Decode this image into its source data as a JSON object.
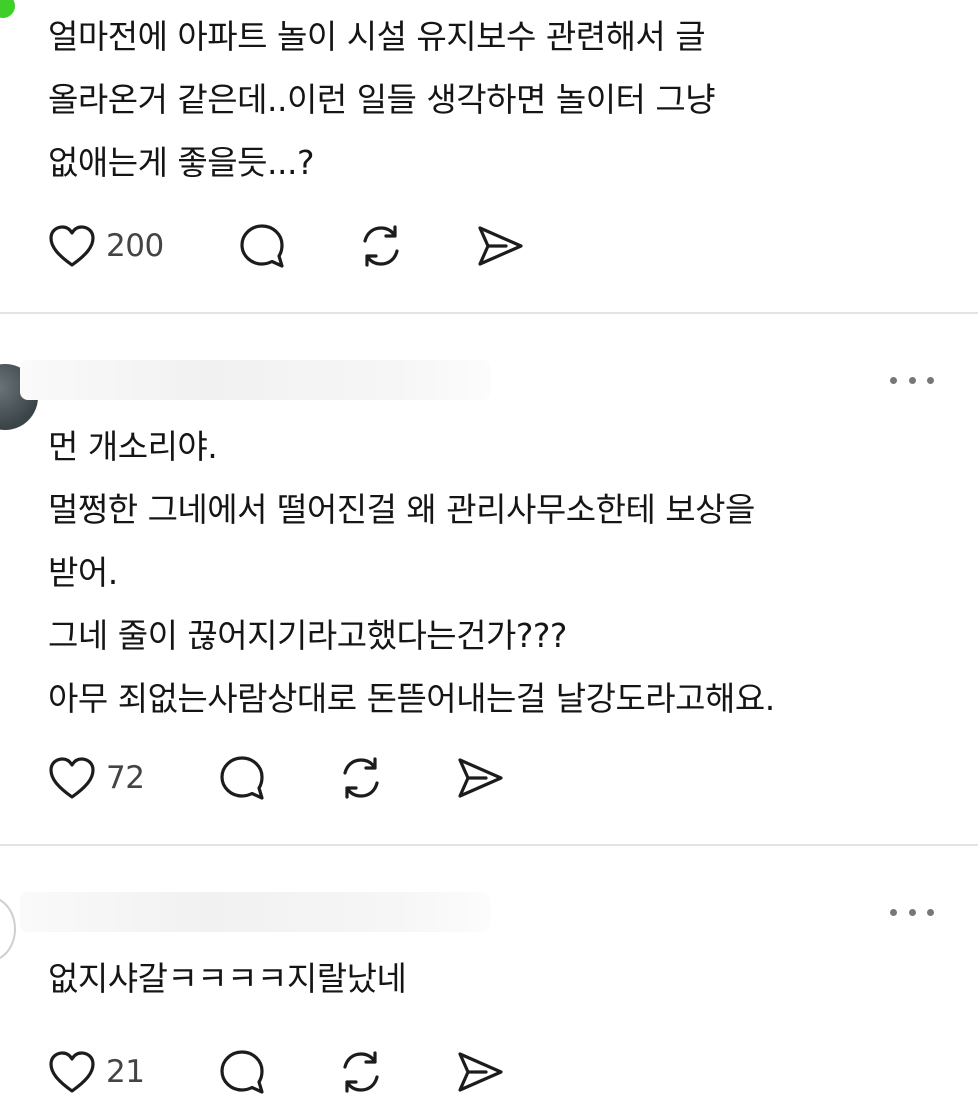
{
  "posts": [
    {
      "lines": [
        "얼마전에 아파트 놀이 시설 유지보수 관련해서 글",
        "올라온거 같은데..이런 일들 생각하면 놀이터 그냥",
        "없애는게 좋을듯...?"
      ],
      "likes": "200"
    },
    {
      "lines": [
        "먼 개소리야.",
        "멀쩡한 그네에서 떨어진걸 왜 관리사무소한테 보상을",
        "받어.",
        "그네 줄이 끊어지기라고했다는건가???",
        "아무 죄없는사람상대로 돈뜯어내는걸 날강도라고해요."
      ],
      "likes": "72"
    },
    {
      "lines": [
        "없지샤갈ㅋㅋㅋㅋ지랄났네"
      ],
      "likes": "21"
    }
  ],
  "icons": {
    "like": "heart-icon",
    "reply": "comment-bubble-icon",
    "repost": "repost-icon",
    "share": "send-icon",
    "more": "more-dots-icon"
  },
  "colors": {
    "online_dot": "#3ecf2b",
    "divider": "#e4e4e4",
    "icon": "#1c1c1c"
  }
}
